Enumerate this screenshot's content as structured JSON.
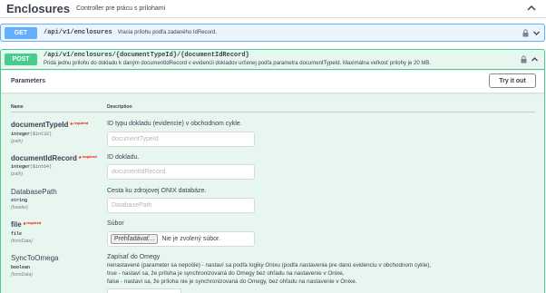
{
  "tag": {
    "title": "Enclosures",
    "description": "Controller pre prácu s prílohami",
    "chevron_icon": "chevron-up-icon"
  },
  "get_op": {
    "method": "GET",
    "path": "/api/v1/enclosures",
    "summary": "Vracia prílohu podľa zadaného IdRecord.",
    "color": "#61affe"
  },
  "post_op": {
    "method": "POST",
    "path": "/api/v1/enclosures/{documentTypeId}/{documentIdRecord}",
    "summary": "Pridá jednu prílohu do dokladu k daným documentIdRecord v evidencii dokladov určenej podľa parametra documentTypeId. Maximálna veľkosť prílohy je 20 MB.",
    "color": "#49cc90"
  },
  "parameters": {
    "title": "Parameters",
    "try_button": "Try it out",
    "col_name": "Name",
    "col_desc": "Description",
    "required_star": "*",
    "required_label": "required",
    "items": [
      {
        "name": "documentTypeId",
        "type": "integer",
        "format": "($int32)",
        "in": "(path)",
        "description": "ID typu dokladu (evidencie) v obchodnom cykle.",
        "placeholder": "documentTypeId"
      },
      {
        "name": "documentIdRecord",
        "type": "integer",
        "format": "($int64)",
        "in": "(path)",
        "description": "ID dokladu.",
        "placeholder": "documentIdRecord"
      },
      {
        "name": "DatabasePath",
        "type": "string",
        "format": "",
        "in": "(header)",
        "description": "Cesta ku zdrojovej ONIX databáze.",
        "placeholder": "DatabasePath"
      },
      {
        "name": "file",
        "type": "file",
        "format": "",
        "in": "(formData)",
        "description": "Súbor",
        "file_button": "Prehľadávať...",
        "file_status": "Nie je zvolený súbor."
      },
      {
        "name": "SyncToOmega",
        "type": "boolean",
        "format": "",
        "in": "(formData)",
        "description": "Zapísať do Omegy",
        "lines": [
          "nenastavené (parameter sa nepošle) - nastaví sa podľa logiky Onixu (podľa nastavenia pre danú evidenciu v obchodnom cykle),",
          "true - nastaví sa, že príloha je synchronizovaná do Omegy bez ohľadu na nastavenie v Onixe,",
          "false - nastaví sa, že príloha nie je synchronizovaná do Omegy, bez ohľadu na nastavenie v Onixe."
        ]
      }
    ]
  }
}
